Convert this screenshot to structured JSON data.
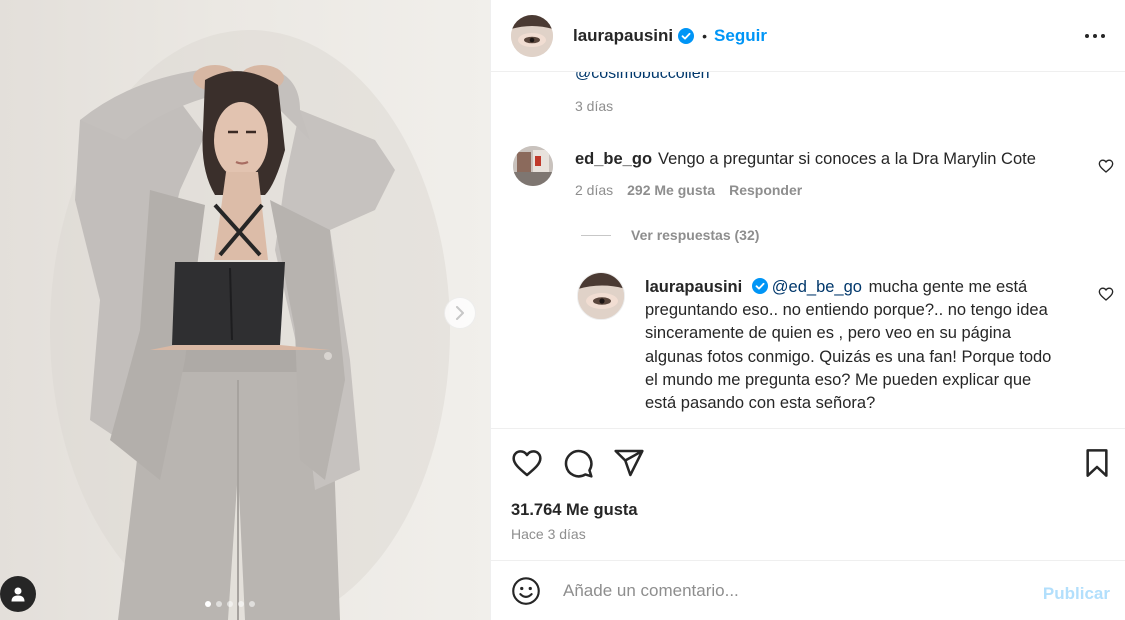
{
  "post": {
    "author": "laurapausini",
    "follow_label": "Seguir",
    "separator": "•",
    "image_dots_total": 5,
    "image_dots_active": 1
  },
  "comments": {
    "previous": {
      "mention": "@cosimobuccolieri",
      "time": "3 días"
    },
    "comment1": {
      "author": "ed_be_go",
      "text": "Vengo a preguntar si conoces a la Dra Marylin Cote",
      "time": "2 días",
      "likes": "292 Me gusta",
      "reply_label": "Responder",
      "view_replies": "Ver respuestas (32)"
    },
    "reply1": {
      "author": "laurapausini",
      "mention": "@ed_be_go",
      "text": "mucha gente me está preguntando eso.. no entiendo porque?.. no tengo idea sinceramente de quien es , pero veo en su página algunas fotos conmigo. Quizás es una fan! Porque todo el mundo me pregunta eso? Me pueden explicar que está pasando con esta señora?"
    }
  },
  "actions": {
    "like_icon": "heart-icon",
    "comment_icon": "comment-icon",
    "share_icon": "paper-plane-icon",
    "save_icon": "bookmark-icon",
    "likes_total": "31.764 Me gusta",
    "posted": "Hace 3 días"
  },
  "add_comment": {
    "placeholder": "Añade un comentario...",
    "publish_label": "Publicar"
  },
  "colors": {
    "link_blue": "#0095f6",
    "mention_blue": "#00376b",
    "muted": "#8e8e8e",
    "publish_disabled": "#b2dffc",
    "text": "#262626"
  }
}
